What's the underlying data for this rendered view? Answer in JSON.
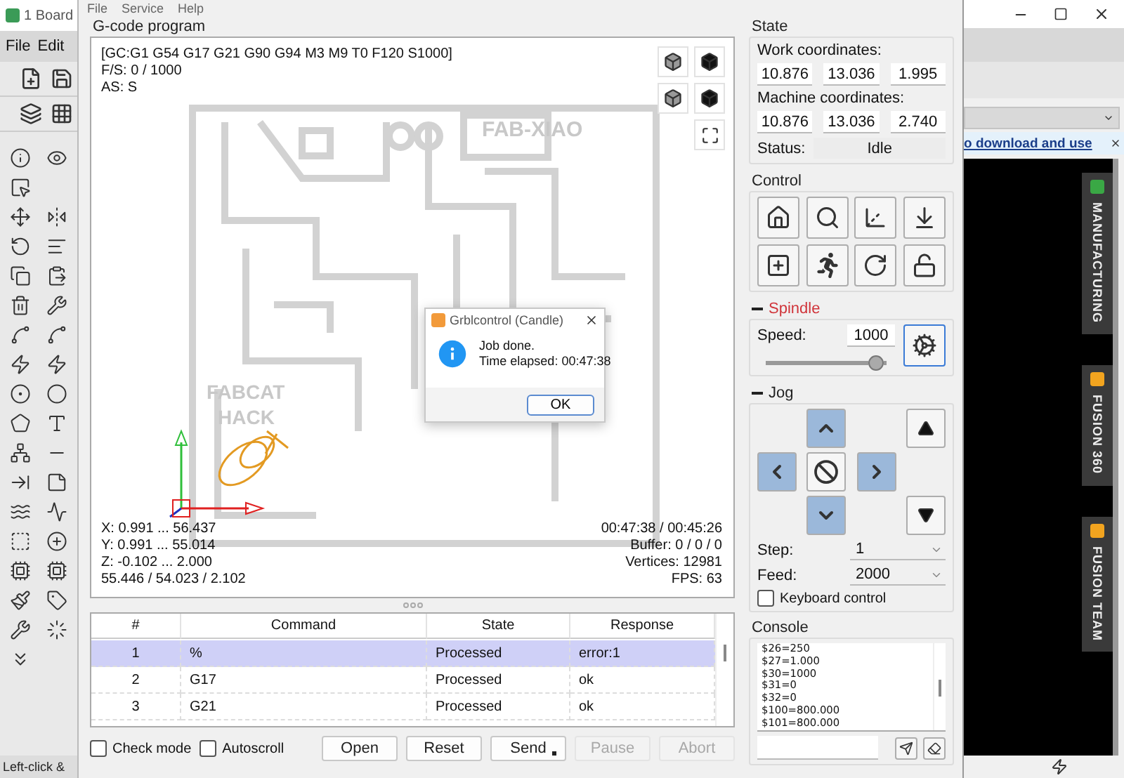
{
  "background_app_left": {
    "title": "1 Board",
    "menu": [
      "File",
      "Edit"
    ],
    "status": "Left-click &"
  },
  "window": {
    "menu": [
      "File",
      "Service",
      "Help"
    ]
  },
  "gcode_program": {
    "title": "G-code program",
    "view": {
      "info_top": [
        "[GC:G1 G54 G17 G21 G90 G94 M3 M9 T0 F120 S1000]",
        "F/S: 0 / 1000",
        "AS: S"
      ],
      "info_bottom_left": [
        "X: 0.991 ... 56.437",
        "Y: 0.991 ... 55.014",
        "Z: -0.102 ... 2.000",
        "55.446 / 54.023 / 2.102"
      ],
      "info_bottom_right": [
        "00:47:38 / 00:45:26",
        "Buffer: 0 / 0 / 0",
        "Vertices: 12981",
        "FPS: 63"
      ],
      "board_labels": [
        "FAB-XIAO",
        "FABCAT",
        "HACK"
      ]
    },
    "table": {
      "columns": [
        "#",
        "Command",
        "State",
        "Response"
      ],
      "rows": [
        {
          "cells": [
            "1",
            "%",
            "Processed",
            "error:1"
          ],
          "selected": true
        },
        {
          "cells": [
            "2",
            "G17",
            "Processed",
            "ok"
          ],
          "selected": false
        },
        {
          "cells": [
            "3",
            "G21",
            "Processed",
            "ok"
          ],
          "selected": false
        }
      ]
    },
    "options": [
      {
        "label": "Check mode",
        "checked": false
      },
      {
        "label": "Autoscroll",
        "checked": false
      }
    ],
    "buttons": [
      {
        "label": "Open",
        "disabled": false,
        "menu": false
      },
      {
        "label": "Reset",
        "disabled": false,
        "menu": false
      },
      {
        "label": "Send",
        "disabled": false,
        "menu": true
      },
      {
        "label": "Pause",
        "disabled": true,
        "menu": false
      },
      {
        "label": "Abort",
        "disabled": true,
        "menu": false
      }
    ]
  },
  "dialog": {
    "title": "Grblcontrol  (Candle)",
    "lines": [
      "Job done.",
      "Time elapsed: 00:47:38"
    ],
    "button": "OK"
  },
  "state": {
    "title": "State",
    "work_label": "Work coordinates:",
    "work": [
      "10.876",
      "13.036",
      "1.995"
    ],
    "machine_label": "Machine coordinates:",
    "machine": [
      "10.876",
      "13.036",
      "2.740"
    ],
    "status_label": "Status:",
    "status": "Idle"
  },
  "control": {
    "title": "Control"
  },
  "spindle": {
    "title": "Spindle",
    "speed_label": "Speed:",
    "speed": "1000",
    "level": 0.97,
    "on": true
  },
  "jog": {
    "title": "Jog",
    "step_label": "Step:",
    "step": "1",
    "feed_label": "Feed:",
    "feed": "2000",
    "keyboard": {
      "label": "Keyboard control",
      "checked": false
    }
  },
  "console": {
    "title": "Console",
    "lines": [
      "$26=250",
      "$27=1.000",
      "$30=1000",
      "$31=0",
      "$32=0",
      "$100=800.000",
      "$101=800.000"
    ]
  },
  "background_app_right": {
    "link": "o download and use",
    "tabs": [
      "MANUFACTURING",
      "FUSION 360",
      "FUSION TEAM"
    ]
  }
}
